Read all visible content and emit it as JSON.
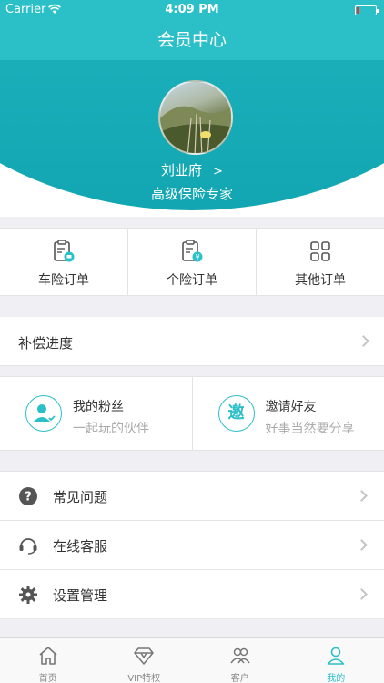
{
  "status_bar": {
    "carrier": "Carrier",
    "time": "4:09 PM"
  },
  "nav": {
    "title": "会员中心"
  },
  "profile": {
    "name": "刘业府",
    "role": "高级保险专家"
  },
  "orders": [
    {
      "label": "车险订单",
      "icon": "car-insurance-order-icon"
    },
    {
      "label": "个险订单",
      "icon": "personal-insurance-order-icon"
    },
    {
      "label": "其他订单",
      "icon": "other-orders-grid-icon"
    }
  ],
  "progress": {
    "label": "补偿进度"
  },
  "social": [
    {
      "title": "我的粉丝",
      "subtitle": "一起玩的伙伴",
      "icon": "fans-icon"
    },
    {
      "title": "邀请好友",
      "subtitle": "好事当然要分享",
      "icon": "invite-icon",
      "glyph": "邀"
    }
  ],
  "menu": [
    {
      "label": "常见问题",
      "icon": "question-icon"
    },
    {
      "label": "在线客服",
      "icon": "headset-icon"
    },
    {
      "label": "设置管理",
      "icon": "gear-icon"
    }
  ],
  "tabs": [
    {
      "label": "首页",
      "icon": "home-icon",
      "active": false
    },
    {
      "label": "VIP特权",
      "icon": "diamond-icon",
      "active": false
    },
    {
      "label": "客户",
      "icon": "customers-icon",
      "active": false
    },
    {
      "label": "我的",
      "icon": "user-icon",
      "active": true
    }
  ],
  "colors": {
    "accent": "#2bbfc8"
  }
}
